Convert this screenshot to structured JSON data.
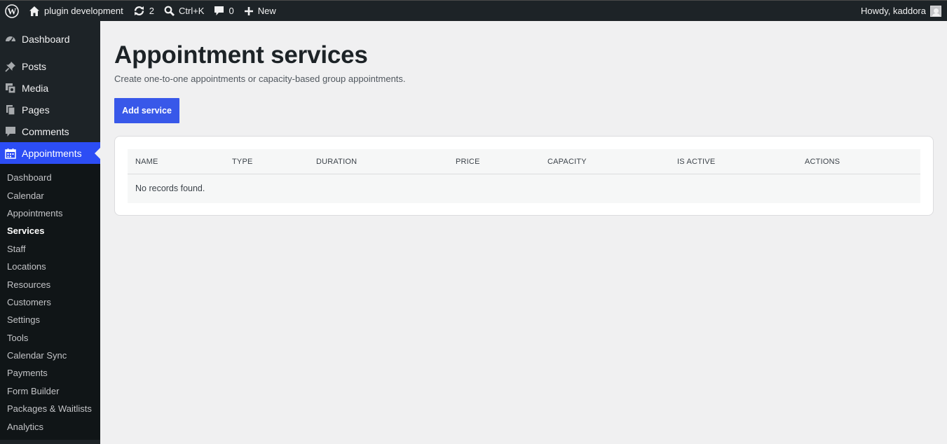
{
  "adminbar": {
    "site_name": "plugin development",
    "updates_count": "2",
    "search_shortcut": "Ctrl+K",
    "comments_count": "0",
    "new_label": "New",
    "greeting": "Howdy, kaddora"
  },
  "sidebar": {
    "menu": {
      "dashboard": "Dashboard",
      "posts": "Posts",
      "media": "Media",
      "pages": "Pages",
      "comments": "Comments",
      "appointments": "Appointments"
    },
    "submenu": [
      {
        "label": "Dashboard"
      },
      {
        "label": "Calendar"
      },
      {
        "label": "Appointments"
      },
      {
        "label": "Services"
      },
      {
        "label": "Staff"
      },
      {
        "label": "Locations"
      },
      {
        "label": "Resources"
      },
      {
        "label": "Customers"
      },
      {
        "label": "Settings"
      },
      {
        "label": "Tools"
      },
      {
        "label": "Calendar Sync"
      },
      {
        "label": "Payments"
      },
      {
        "label": "Form Builder"
      },
      {
        "label": "Packages & Waitlists"
      },
      {
        "label": "Analytics"
      }
    ],
    "current_submenu": "Services"
  },
  "page": {
    "title": "Appointment services",
    "subtitle": "Create one-to-one appointments or capacity-based group appointments.",
    "add_button": "Add service"
  },
  "table": {
    "columns": [
      "NAME",
      "TYPE",
      "DURATION",
      "PRICE",
      "CAPACITY",
      "IS ACTIVE",
      "ACTIONS"
    ],
    "empty_message": "No records found."
  },
  "colors": {
    "admin_bar": "#1d2327",
    "active_menu": "#2c4df5",
    "primary_button": "#3858e9",
    "page_background": "#f0f0f1"
  },
  "icons": [
    "wordpress-logo-icon",
    "home-icon",
    "updates-icon",
    "search-icon",
    "comment-icon",
    "plus-icon",
    "avatar",
    "dashboard-icon",
    "pin-icon",
    "media-icon",
    "pages-icon",
    "comments-icon",
    "calendar-icon"
  ]
}
